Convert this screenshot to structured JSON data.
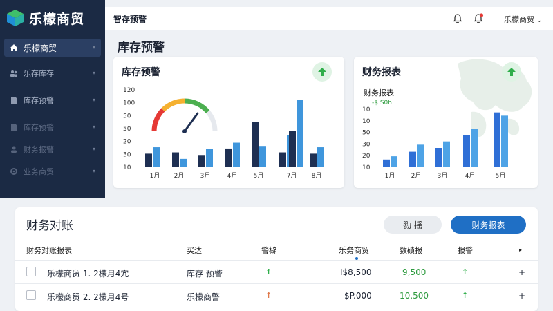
{
  "brand": {
    "name": "乐檬商贸"
  },
  "sidebar": {
    "items": [
      {
        "label": "乐檬商贸",
        "icon": "home-icon"
      },
      {
        "label": "乐存库存",
        "icon": "users-icon"
      },
      {
        "label": "库存预警",
        "icon": "document-icon"
      },
      {
        "label": "库存预警",
        "icon": "document-icon"
      },
      {
        "label": "财务报警",
        "icon": "user-icon"
      },
      {
        "label": "业务商贸",
        "icon": "gear-icon"
      }
    ]
  },
  "header": {
    "title": "智存预警",
    "user": "乐檬商贸"
  },
  "section_title": "库存预警",
  "chart_data": [
    {
      "type": "bar",
      "title": "库存预警",
      "categories": [
        "1月",
        "2月",
        "3月",
        "4月",
        "5月",
        "",
        "7月",
        "8月"
      ],
      "series": [
        {
          "values": [
            21,
            23,
            19,
            29,
            70,
            23,
            56,
            21
          ]
        },
        {
          "values": [
            31,
            13,
            28,
            38,
            33,
            50,
            105,
            31
          ]
        }
      ],
      "yticks": [
        "120",
        "100",
        "50",
        "50",
        "20",
        "30",
        "10"
      ],
      "gauge_value": 0.7,
      "colors": [
        "#1e2f52",
        "#3f96dc"
      ]
    },
    {
      "type": "bar",
      "title": "财务报表",
      "subtitle": "财务报表",
      "annotation": "-$.S0h",
      "categories": [
        "1月",
        "2月",
        "3月",
        "4月",
        "5月"
      ],
      "series": [
        {
          "values": [
            12,
            24,
            30,
            50,
            85
          ]
        },
        {
          "values": [
            17,
            35,
            40,
            60,
            80
          ]
        }
      ],
      "yticks": [
        "10",
        "10",
        "50",
        "30",
        "20",
        "10"
      ],
      "colors": [
        "#2f6fd6",
        "#4ea3e6"
      ]
    }
  ],
  "table": {
    "title": "财务对账",
    "button_secondary": "勠 揺",
    "button_primary": "财务报表",
    "headers": [
      "财务对账报表",
      "买达",
      "警檘",
      "乐务商贸",
      "数磧报",
      "报警",
      "▸"
    ],
    "rows": [
      {
        "name": "乐檬商贸  1. 2檬月4宂",
        "status": "库存 预警",
        "trend": "up",
        "amount": "$8,500",
        "amount_prefix": "I",
        "count": "9,500",
        "alert": "up",
        "action": "+"
      },
      {
        "name": "乐檬商贸  2. 2檬月4号",
        "status": "乐檬商警",
        "trend": "up-red",
        "amount": "$P.000",
        "amount_prefix": "",
        "count": "10,500",
        "alert": "up",
        "action": "+"
      }
    ]
  }
}
